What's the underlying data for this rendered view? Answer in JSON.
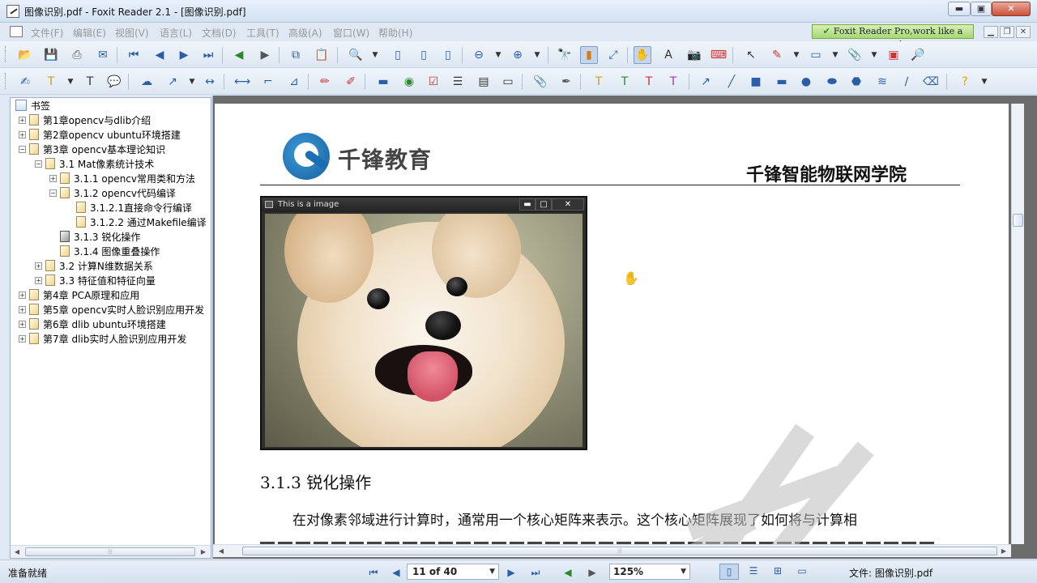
{
  "window": {
    "title": "图像识别.pdf - Foxit Reader 2.1 - [图像识别.pdf]",
    "min": "▬",
    "max": "▣",
    "close": "✕"
  },
  "menu": {
    "items": [
      "文件(F)",
      "编辑(E)",
      "视图(V)",
      "语言(L)",
      "文档(D)",
      "工具(T)",
      "高级(A)",
      "窗口(W)",
      "帮助(H)"
    ],
    "promo": "Foxit Reader Pro,work like a pro!"
  },
  "bookmarks": {
    "root": "书签",
    "items": [
      {
        "label": "第1章opencv与dlib介绍",
        "level": 1,
        "expander": "+"
      },
      {
        "label": "第2章opencv ubuntu环境搭建",
        "level": 1,
        "expander": "+"
      },
      {
        "label": "第3章 opencv基本理论知识",
        "level": 1,
        "expander": "−"
      },
      {
        "label": "3.1 Mat像素统计技术",
        "level": 2,
        "expander": "−"
      },
      {
        "label": "3.1.1 opencv常用类和方法",
        "level": 3,
        "expander": "+"
      },
      {
        "label": "3.1.2 opencv代码编译",
        "level": 3,
        "expander": "−"
      },
      {
        "label": "3.1.2.1直接命令行编译",
        "level": 4,
        "expander": ""
      },
      {
        "label": "3.1.2.2 通过Makefile编译",
        "level": 4,
        "expander": ""
      },
      {
        "label": "3.1.3 锐化操作",
        "level": 3,
        "expander": "",
        "selected": true
      },
      {
        "label": "3.1.4 图像重叠操作",
        "level": 3,
        "expander": ""
      },
      {
        "label": "3.2  计算N维数据关系",
        "level": 2,
        "expander": "+"
      },
      {
        "label": "3.3 特征值和特征向量",
        "level": 2,
        "expander": "+"
      },
      {
        "label": "第4章 PCA原理和应用",
        "level": 1,
        "expander": "+"
      },
      {
        "label": "第5章 opencv实时人脸识别应用开发",
        "level": 1,
        "expander": "+"
      },
      {
        "label": "第6章 dlib ubuntu环境搭建",
        "level": 1,
        "expander": "+"
      },
      {
        "label": "第7章 dlib实时人脸识别应用开发",
        "level": 1,
        "expander": "+"
      }
    ]
  },
  "document": {
    "logo_text": "千锋教育",
    "header_right": "千锋智能物联网学院",
    "image_window_title": "This is a image",
    "image_ctrl_min": "▬",
    "image_ctrl_max": "□",
    "image_ctrl_close": "✕",
    "section_heading": "3.1.3 锐化操作",
    "paragraph": "在对像素邻域进行计算时，通常用一个核心矩阵来表示。这个核心矩阵展现了如何将与计算相"
  },
  "statusbar": {
    "status": "准备就绪",
    "page_indicator": "11 of 40",
    "zoom": "125%",
    "file_label": "文件: 图像识别.pdf"
  },
  "colors": {
    "accent": "#2a5fa8",
    "logo_blue": "#1a6fb2",
    "promo_green": "#a6d873"
  }
}
